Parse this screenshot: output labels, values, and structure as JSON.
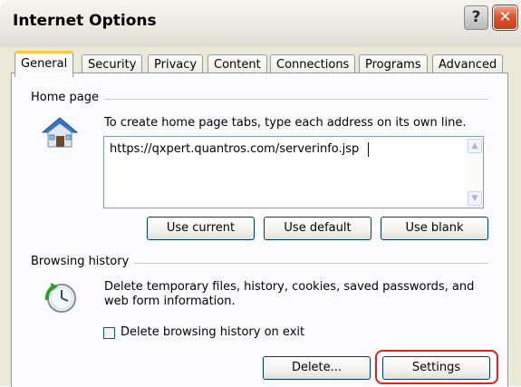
{
  "window": {
    "title": "Internet Options",
    "help_button": "?",
    "close_button": "✕"
  },
  "tabs": [
    "General",
    "Security",
    "Privacy",
    "Content",
    "Connections",
    "Programs",
    "Advanced"
  ],
  "active_tab": "General",
  "home_page": {
    "section_label": "Home page",
    "instruction": "To create home page tabs, type each address on its own line.",
    "url": "https://qxpert.quantros.com/serverinfo.jsp",
    "buttons": {
      "use_current": "Use current",
      "use_default": "Use default",
      "use_blank": "Use blank"
    },
    "icon": "home-house-icon"
  },
  "browsing_history": {
    "section_label": "Browsing history",
    "description": "Delete temporary files, history, cookies, saved passwords, and web form information.",
    "checkbox_label": "Delete browsing history on exit",
    "checkbox_checked": false,
    "buttons": {
      "delete": "Delete...",
      "settings": "Settings"
    },
    "icon": "history-clock-icon",
    "highlighted_button": "Settings"
  },
  "colors": {
    "highlight": "#e0211c",
    "tab_accent": "#ffc83c",
    "dialog_background": "#ece9d8"
  }
}
